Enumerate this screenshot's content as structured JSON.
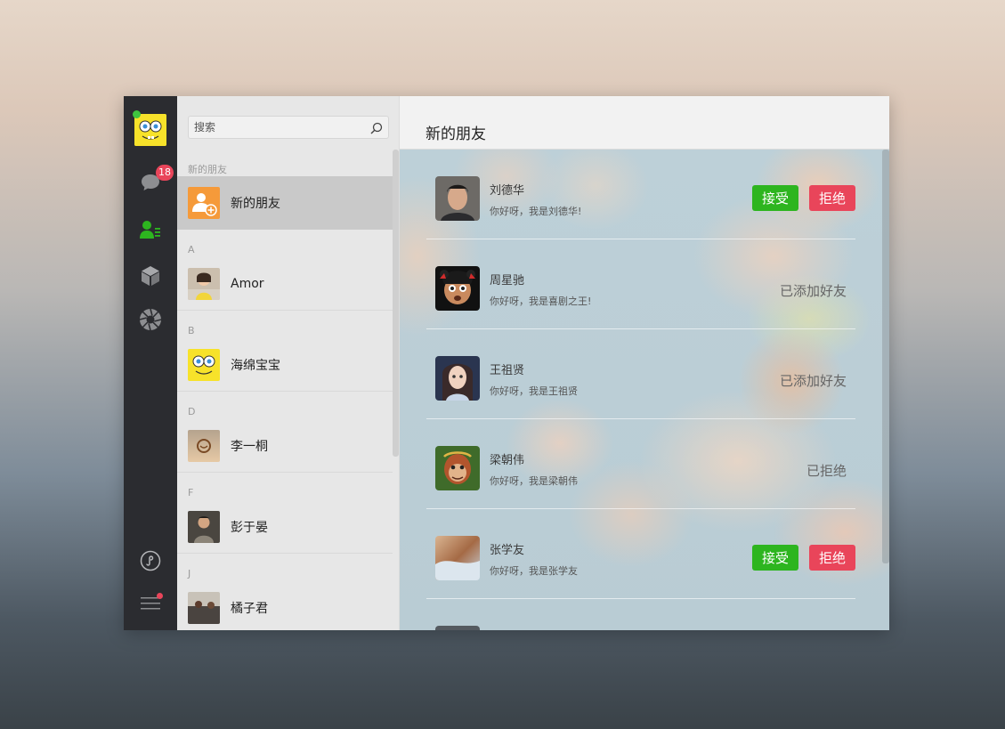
{
  "sidebar": {
    "unread_badge": "18"
  },
  "contacts": {
    "search_placeholder": "搜索",
    "new_friends_section": "新的朋友",
    "new_friends_label": "新的朋友",
    "groups": [
      {
        "letter": "A",
        "name": "Amor"
      },
      {
        "letter": "B",
        "name": "海绵宝宝"
      },
      {
        "letter": "D",
        "name": "李一桐"
      },
      {
        "letter": "F",
        "name": "彭于晏"
      },
      {
        "letter": "J",
        "name": "橘子君"
      }
    ]
  },
  "main": {
    "title": "新的朋友",
    "accept_label": "接受",
    "reject_label": "拒绝",
    "requests": [
      {
        "name": "刘德华",
        "message": "你好呀，我是刘德华!",
        "state": "pending"
      },
      {
        "name": "周星驰",
        "message": "你好呀，我是喜剧之王!",
        "state": "added",
        "status_text": "已添加好友"
      },
      {
        "name": "王祖贤",
        "message": "你好呀，我是王祖贤",
        "state": "added",
        "status_text": "已添加好友"
      },
      {
        "name": "梁朝伟",
        "message": "你好呀，我是梁朝伟",
        "state": "rejected",
        "status_text": "已拒绝"
      },
      {
        "name": "张学友",
        "message": "你好呀，我是张学友",
        "state": "pending"
      }
    ]
  },
  "colors": {
    "accept": "#2db51f",
    "reject": "#e9455a",
    "rail": "#2b2c30",
    "badge": "#e9455a"
  }
}
